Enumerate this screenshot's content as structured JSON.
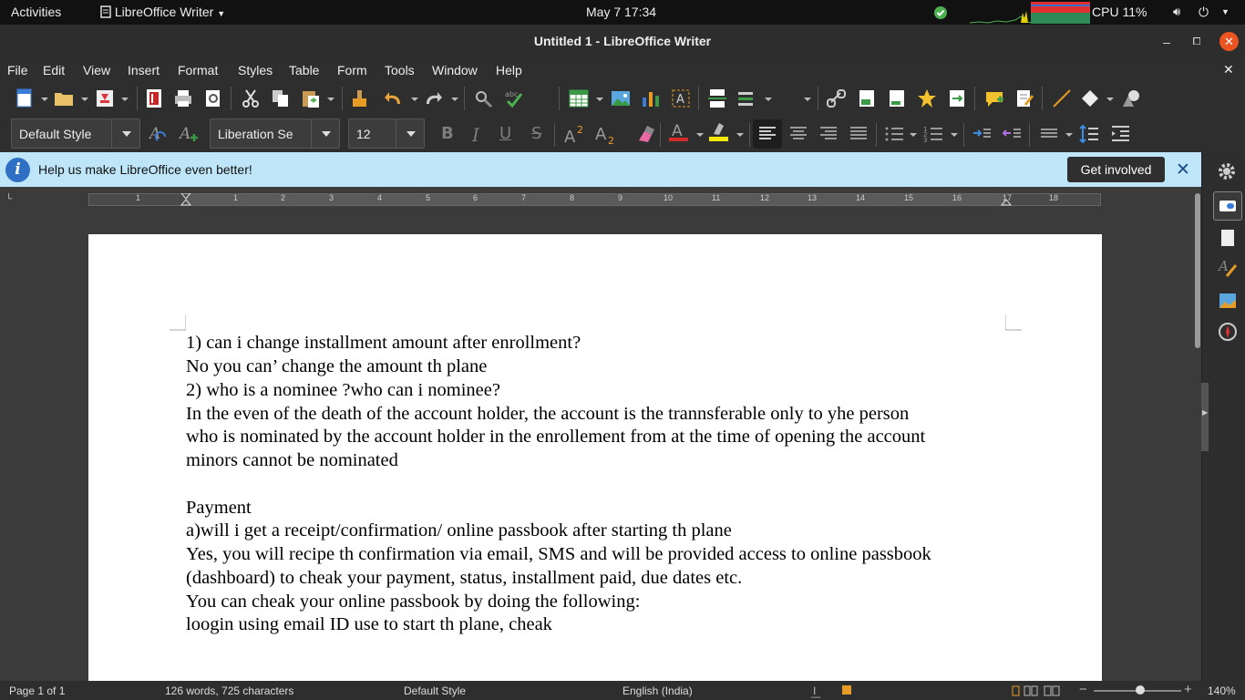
{
  "topbar": {
    "activities": "Activities",
    "app_name": "LibreOffice Writer",
    "datetime": "May 7  17:34",
    "cpu": "CPU 11%"
  },
  "window": {
    "title": "Untitled 1 - LibreOffice Writer"
  },
  "menu": [
    "File",
    "Edit",
    "View",
    "Insert",
    "Format",
    "Styles",
    "Table",
    "Form",
    "Tools",
    "Window",
    "Help"
  ],
  "toolbar": {
    "paragraph_style": "Default Style",
    "font_name": "Liberation Se",
    "font_size": "12"
  },
  "infobar": {
    "message": "Help us make LibreOffice even better!",
    "button": "Get involved"
  },
  "ruler": {
    "ticks": [
      "1",
      "1",
      "2",
      "3",
      "4",
      "5",
      "6",
      "7",
      "8",
      "9",
      "10",
      "11",
      "12",
      "13",
      "14",
      "15",
      "16",
      "17",
      "18"
    ]
  },
  "document": {
    "lines": [
      "1) can i change installment amount after enrollment?",
      "No you can’ change the amount th plane",
      "2) who is a nominee ?who can i nominee?",
      "In the even of the death of the account holder, the account is the trannsferable only to yhe person",
      "who is nominated by the account holder in the enrollement from at the time of opening the account",
      "minors cannot be nominated",
      "",
      "Payment",
      "a)will i get a receipt/confirmation/ online passbook after starting th plane",
      "Yes, you will recipe th confirmation via email, SMS and will be provided access to online passbook",
      "(dashboard) to cheak your payment, status, installment paid, due dates etc.",
      "You can cheak your online passbook by doing the following:",
      "loogin using email ID use to start th plane, cheak"
    ]
  },
  "status": {
    "page": "Page 1 of 1",
    "words": "126 words, 725 characters",
    "style": "Default Style",
    "language": "English (India)",
    "zoom": "140%"
  },
  "colors": {
    "infobar_bg": "#bee6f8",
    "font_color_bar": "#d42a2a",
    "highlight_bar": "#f5e90a"
  }
}
